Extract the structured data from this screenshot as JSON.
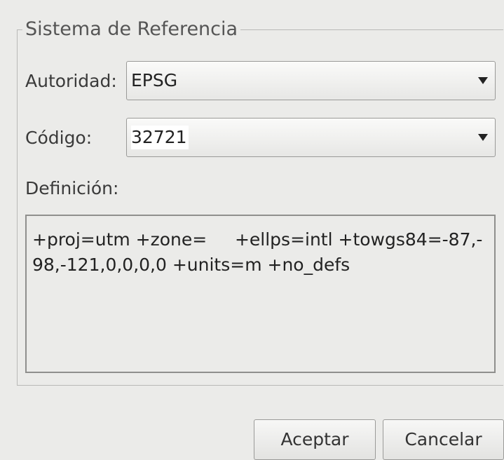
{
  "group": {
    "title": "Sistema de Referencia"
  },
  "authority": {
    "label": "Autoridad:",
    "value": "EPSG"
  },
  "code": {
    "label": "Código:",
    "value": "32721"
  },
  "definition": {
    "label": "Definición:",
    "text": "+proj=utm +zone=     +ellps=intl +towgs84=-87,-98,-121,0,0,0,0 +units=m +no_defs"
  },
  "buttons": {
    "accept": "Aceptar",
    "cancel": "Cancelar"
  },
  "icons": {
    "dropdown": "chevron-down-icon"
  }
}
